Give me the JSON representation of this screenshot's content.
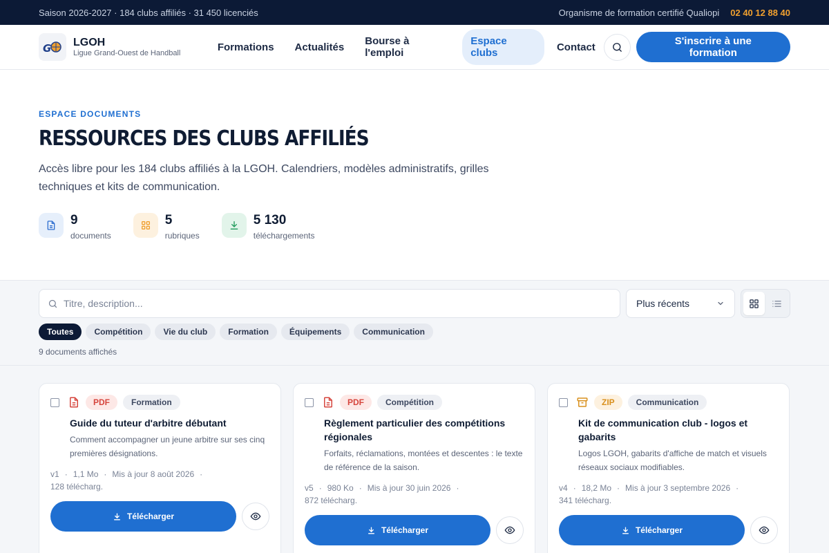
{
  "topbar": {
    "season": "Saison 2026-2027 · 184 clubs affiliés · 31 450 licenciés",
    "qualiopi": "Organisme de formation certifié Qualiopi",
    "phone": "02 40 12 88 40"
  },
  "header": {
    "brand_name": "LGOH",
    "brand_sub": "Ligue Grand-Ouest de Handball",
    "nav": [
      {
        "label": "Formations",
        "active": false
      },
      {
        "label": "Actualités",
        "active": false
      },
      {
        "label": "Bourse à l'emploi",
        "active": false
      },
      {
        "label": "Espace clubs",
        "active": true
      },
      {
        "label": "Contact",
        "active": false
      }
    ],
    "cta": "S'inscrire à une formation"
  },
  "hero": {
    "eyebrow": "ESPACE DOCUMENTS",
    "title": "RESSOURCES DES CLUBS AFFILIÉS",
    "description": "Accès libre pour les 184 clubs affiliés à la LGOH. Calendriers, modèles administratifs, grilles techniques et kits de communication.",
    "stats": [
      {
        "value": "9",
        "label": "documents",
        "icon": "document-icon",
        "color": "#2f6fd0",
        "bg": "#e6effb"
      },
      {
        "value": "5",
        "label": "rubriques",
        "icon": "grid-icon",
        "color": "#f0a02f",
        "bg": "#fdf1df"
      },
      {
        "value": "5 130",
        "label": "téléchargements",
        "icon": "download-icon",
        "color": "#1f9a5a",
        "bg": "#e2f4ea"
      }
    ]
  },
  "toolbar": {
    "search_placeholder": "Titre, description...",
    "sort_value": "Plus récents",
    "chips": [
      {
        "label": "Toutes",
        "active": true
      },
      {
        "label": "Compétition",
        "active": false
      },
      {
        "label": "Vie du club",
        "active": false
      },
      {
        "label": "Formation",
        "active": false
      },
      {
        "label": "Équipements",
        "active": false
      },
      {
        "label": "Communication",
        "active": false
      }
    ],
    "count": "9 documents affichés"
  },
  "documents": [
    {
      "type": "PDF",
      "type_color": "#d6453d",
      "type_bg": "#fde8e6",
      "icon": "pdf-file-icon",
      "category": "Formation",
      "title": "Guide du tuteur d'arbitre débutant",
      "description": "Comment accompagner un jeune arbitre sur ses cinq premières désignations.",
      "version": "v1",
      "size": "1,1 Mo",
      "updated": "Mis à jour 8 août 2026",
      "downloads": "128 télécharg.",
      "download_label": "Télécharger"
    },
    {
      "type": "PDF",
      "type_color": "#d6453d",
      "type_bg": "#fde8e6",
      "icon": "pdf-file-icon",
      "category": "Compétition",
      "title": "Règlement particulier des compétitions régionales",
      "description": "Forfaits, réclamations, montées et descentes : le texte de référence de la saison.",
      "version": "v5",
      "size": "980 Ko",
      "updated": "Mis à jour 30 juin 2026",
      "downloads": "872 télécharg.",
      "download_label": "Télécharger"
    },
    {
      "type": "ZIP",
      "type_color": "#d9901d",
      "type_bg": "#fdf1df",
      "icon": "archive-icon",
      "category": "Communication",
      "title": "Kit de communication club - logos et gabarits",
      "description": "Logos LGOH, gabarits d'affiche de match et visuels réseaux sociaux modifiables.",
      "version": "v4",
      "size": "18,2 Mo",
      "updated": "Mis à jour 3 septembre 2026",
      "downloads": "341 télécharg.",
      "download_label": "Télécharger"
    }
  ]
}
